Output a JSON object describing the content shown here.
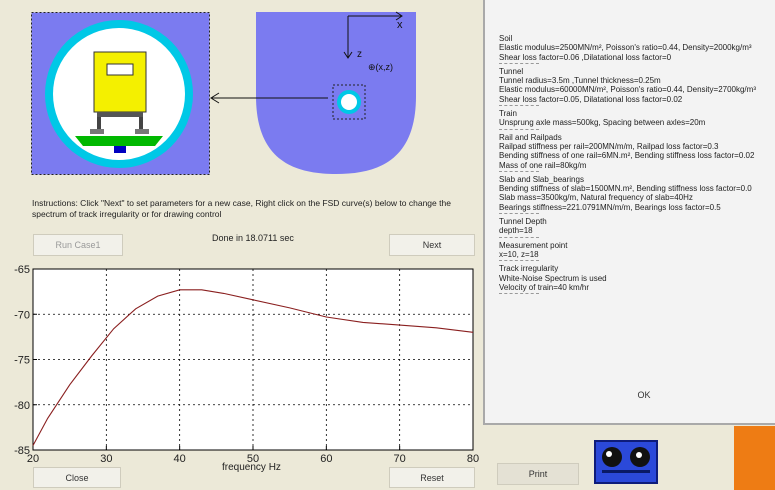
{
  "instructions": "Instructions: Click \"Next\" to set parameters for a new case, Right click on the FSD curve(s) below to change the spectrum of track irregularity or for drawing control",
  "status": "Done in 18.0711 sec",
  "buttons": {
    "run": "Run Case1",
    "next": "Next",
    "close": "Close",
    "reset": "Reset",
    "print": "Print",
    "ok": "OK"
  },
  "diagram": {
    "x_label": "x",
    "z_label": "z",
    "point_label": "⊕(x,z)"
  },
  "colors": {
    "background": "#ece9d8",
    "ground": "#7b7bf0",
    "ring": "#00c8e6",
    "train": "#f4f000",
    "slab": "#00b800",
    "curve": "#8a1f1f"
  },
  "chart_data": {
    "type": "line",
    "xlabel": "frequency Hz",
    "ylabel": "",
    "xlim": [
      20,
      80
    ],
    "ylim": [
      -85,
      -65
    ],
    "xticks": [
      20,
      30,
      40,
      50,
      60,
      70,
      80
    ],
    "yticks": [
      -65,
      -70,
      -75,
      -80,
      -85
    ],
    "grid": true,
    "series": [
      {
        "x": [
          20,
          22,
          25,
          28,
          31,
          34,
          37,
          40,
          43,
          46,
          50,
          55,
          60,
          65,
          70,
          75,
          80
        ],
        "values": [
          -84.5,
          -81.5,
          -77.8,
          -74.6,
          -71.6,
          -69.4,
          -68.0,
          -67.3,
          -67.3,
          -67.7,
          -68.4,
          -69.3,
          -70.3,
          -70.9,
          -71.2,
          -71.5,
          -72.0
        ]
      }
    ]
  },
  "summary": [
    {
      "heading": "Soil",
      "lines": [
        "Elastic modulus=2500MN/m², Poisson's ratio=0.44, Density=2000kg/m³",
        "Shear loss factor=0.06 ,Dilatational loss factor=0"
      ]
    },
    {
      "heading": "Tunnel",
      "lines": [
        "Tunnel radius=3.5m ,Tunnel thickness=0.25m",
        "Elastic modulus=60000MN/m², Poisson's ratio=0.44, Density=2700kg/m³",
        "Shear loss factor=0.05, Dilatational loss factor=0.02"
      ]
    },
    {
      "heading": "Train",
      "lines": [
        "Unsprung axle mass=500kg, Spacing between axles=20m"
      ]
    },
    {
      "heading": "Rail and Railpads",
      "lines": [
        "Railpad stiffness per rail=200MN/m/m, Railpad loss factor=0.3",
        "Bending stiffness of one rail=6MN.m², Bending stiffness loss factor=0.02",
        "Mass of one rail=80kg/m"
      ]
    },
    {
      "heading": "Slab and Slab_bearings",
      "lines": [
        "Bending stiffness of slab=1500MN.m², Bending stiffness loss factor=0.0",
        "Slab mass=3500kg/m, Natural frequency of slab=40Hz",
        "Bearings stiffness=221.0791MN/m/m, Bearings loss factor=0.5"
      ]
    },
    {
      "heading": "Tunnel Depth",
      "lines": [
        "depth=18"
      ]
    },
    {
      "heading": "Measurement point",
      "lines": [
        "x=10, z=18"
      ]
    },
    {
      "heading": "Track irregularity",
      "lines": [
        "White-Noise Spectrum is used",
        "Velocity of train=40 km/hr"
      ]
    }
  ]
}
